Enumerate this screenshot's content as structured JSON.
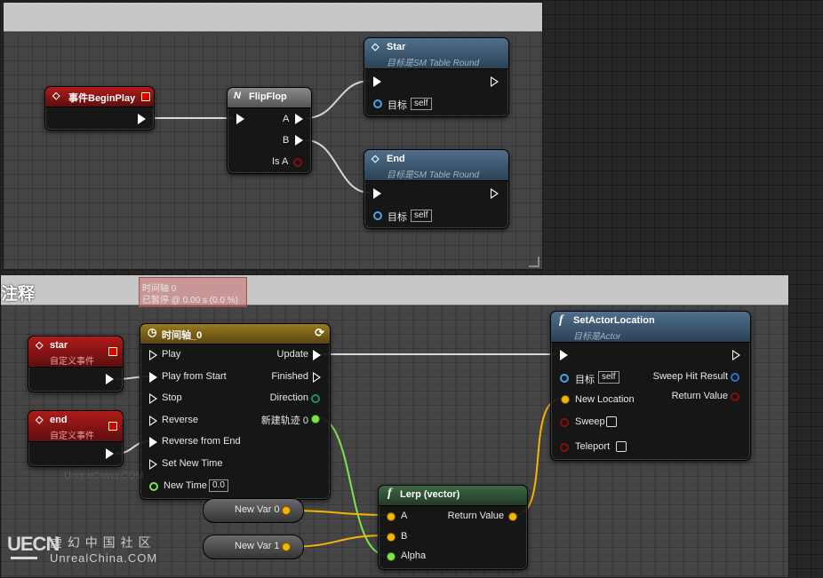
{
  "top_comment": {
    "title": ""
  },
  "bottom_comment": {
    "title": "注释"
  },
  "timeline_tooltip": {
    "line1": "时间轴 0",
    "line2": "已暂停 @ 0.00 s (0.0 %)"
  },
  "nodes": {
    "begin_play": {
      "title": "事件BeginPlay"
    },
    "flipflop": {
      "title": "FlipFlop",
      "pin_a": "A",
      "pin_b": "B",
      "pin_isa": "Is A"
    },
    "star_call": {
      "title": "Star",
      "subtitle": "目标是SM Table Round",
      "target_label": "目标",
      "target_value": "self"
    },
    "end_call": {
      "title": "End",
      "subtitle": "目标是SM Table Round",
      "target_label": "目标",
      "target_value": "self"
    },
    "star_event": {
      "title": "star",
      "subtitle": "自定义事件"
    },
    "end_event": {
      "title": "end",
      "subtitle": "自定义事件"
    },
    "timeline": {
      "title": "时间轴_0",
      "inputs": [
        "Play",
        "Play from Start",
        "Stop",
        "Reverse",
        "Reverse from End",
        "Set New Time"
      ],
      "new_time_label": "New Time",
      "new_time_value": "0.0",
      "outputs": [
        "Update",
        "Finished",
        "Direction",
        "新建轨迹 0"
      ]
    },
    "set_actor_location": {
      "title": "SetActorLocation",
      "subtitle": "目标是Actor",
      "target_label": "目标",
      "target_value": "self",
      "new_location": "New Location",
      "sweep": "Sweep",
      "teleport": "Teleport",
      "sweep_hit_result": "Sweep Hit Result",
      "return_value": "Return Value"
    },
    "lerp": {
      "title": "Lerp (vector)",
      "a": "A",
      "b": "B",
      "alpha": "Alpha",
      "return_value": "Return Value"
    },
    "new_var_0": {
      "label": "New Var 0"
    },
    "new_var_1": {
      "label": "New Var 1"
    }
  },
  "watermark": {
    "logo": "UECN",
    "cn": "虚 幻 中 国 社 区",
    "en": "UnrealChina.COM",
    "faint": "UnrealChina.COM"
  },
  "colors": {
    "exec_wire": "#d8d8d8",
    "vector_wire": "#f5b400",
    "float_wire": "#7fe34c",
    "accent_blue": "#3ea9e6"
  }
}
